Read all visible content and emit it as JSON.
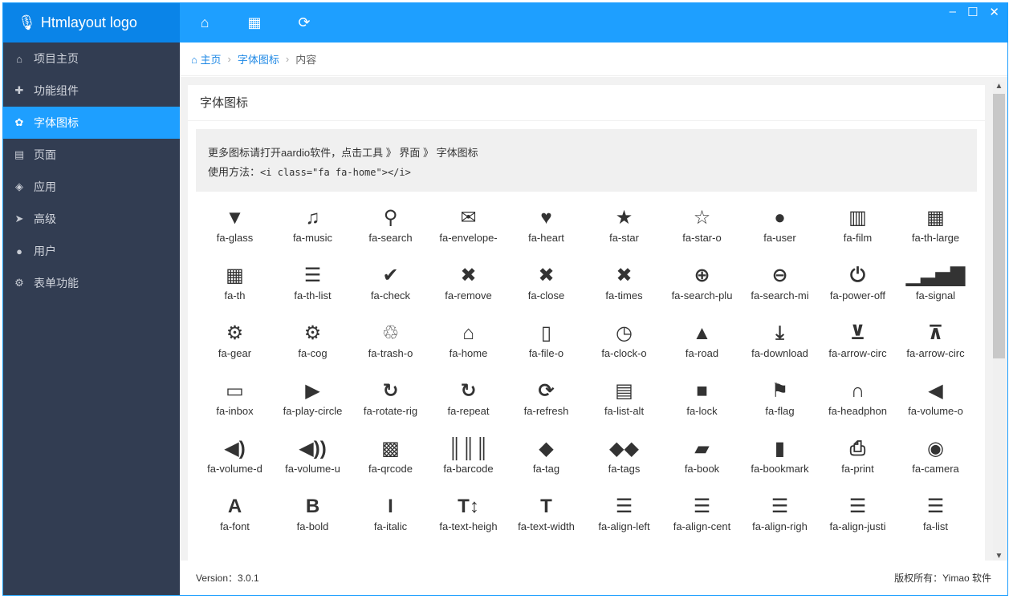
{
  "app": {
    "logo": "Htmlayout logo",
    "logo_icon": "microphone-icon"
  },
  "window": {
    "minimize": "–",
    "maximize": "☐",
    "close": "✕"
  },
  "toolbar": [
    {
      "icon": "home-icon",
      "glyph": "⌂"
    },
    {
      "icon": "calendar-icon",
      "glyph": "▦"
    },
    {
      "icon": "refresh-icon",
      "glyph": "⟳"
    }
  ],
  "sidebar": {
    "items": [
      {
        "label": "项目主页",
        "icon": "home-icon",
        "glyph": "⌂"
      },
      {
        "label": "功能组件",
        "icon": "puzzle-icon",
        "glyph": "✚"
      },
      {
        "label": "字体图标",
        "icon": "gift-icon",
        "glyph": "✿",
        "active": true
      },
      {
        "label": "页面",
        "icon": "file-text-icon",
        "glyph": "▤"
      },
      {
        "label": "应用",
        "icon": "cube-icon",
        "glyph": "◈"
      },
      {
        "label": "高级",
        "icon": "location-arrow-icon",
        "glyph": "➤"
      },
      {
        "label": "用户",
        "icon": "user-icon",
        "glyph": "●"
      },
      {
        "label": "表单功能",
        "icon": "gear-icon",
        "glyph": "⚙"
      }
    ]
  },
  "breadcrumb": {
    "home": "主页",
    "section": "字体图标",
    "current": "内容",
    "sep": "›"
  },
  "card": {
    "title": "字体图标",
    "note_line1": "更多图标请打开aardio软件，点击工具 》 界面 》 字体图标",
    "note_line2_prefix": "使用方法：",
    "note_line2_code": "<i class=\"fa fa-home\"></i>"
  },
  "icons": [
    {
      "g": "▼",
      "l": "fa-glass"
    },
    {
      "g": "♫",
      "l": "fa-music"
    },
    {
      "g": "⚲",
      "l": "fa-search"
    },
    {
      "g": "✉",
      "l": "fa-envelope-"
    },
    {
      "g": "♥",
      "l": "fa-heart"
    },
    {
      "g": "★",
      "l": "fa-star"
    },
    {
      "g": "☆",
      "l": "fa-star-o"
    },
    {
      "g": "●",
      "l": "fa-user"
    },
    {
      "g": "▥",
      "l": "fa-film"
    },
    {
      "g": "▦",
      "l": "fa-th-large"
    },
    {
      "g": "▦",
      "l": "fa-th"
    },
    {
      "g": "☰",
      "l": "fa-th-list"
    },
    {
      "g": "✔",
      "l": "fa-check"
    },
    {
      "g": "✖",
      "l": "fa-remove"
    },
    {
      "g": "✖",
      "l": "fa-close"
    },
    {
      "g": "✖",
      "l": "fa-times"
    },
    {
      "g": "⊕",
      "l": "fa-search-plu"
    },
    {
      "g": "⊖",
      "l": "fa-search-mi"
    },
    {
      "g": "⏻",
      "l": "fa-power-off"
    },
    {
      "g": "▁▃▅▇",
      "l": "fa-signal"
    },
    {
      "g": "⚙",
      "l": "fa-gear"
    },
    {
      "g": "⚙",
      "l": "fa-cog"
    },
    {
      "g": "♲",
      "l": "fa-trash-o"
    },
    {
      "g": "⌂",
      "l": "fa-home"
    },
    {
      "g": "▯",
      "l": "fa-file-o"
    },
    {
      "g": "◷",
      "l": "fa-clock-o"
    },
    {
      "g": "▲",
      "l": "fa-road"
    },
    {
      "g": "⤓",
      "l": "fa-download"
    },
    {
      "g": "⊻",
      "l": "fa-arrow-circ"
    },
    {
      "g": "⊼",
      "l": "fa-arrow-circ"
    },
    {
      "g": "▭",
      "l": "fa-inbox"
    },
    {
      "g": "▶",
      "l": "fa-play-circle"
    },
    {
      "g": "↻",
      "l": "fa-rotate-rig"
    },
    {
      "g": "↻",
      "l": "fa-repeat"
    },
    {
      "g": "⟳",
      "l": "fa-refresh"
    },
    {
      "g": "▤",
      "l": "fa-list-alt"
    },
    {
      "g": "■",
      "l": "fa-lock"
    },
    {
      "g": "⚑",
      "l": "fa-flag"
    },
    {
      "g": "∩",
      "l": "fa-headphon"
    },
    {
      "g": "◀",
      "l": "fa-volume-o"
    },
    {
      "g": "◀)",
      "l": "fa-volume-d"
    },
    {
      "g": "◀))",
      "l": "fa-volume-u"
    },
    {
      "g": "▩",
      "l": "fa-qrcode"
    },
    {
      "g": "║║║",
      "l": "fa-barcode"
    },
    {
      "g": "◆",
      "l": "fa-tag"
    },
    {
      "g": "◆◆",
      "l": "fa-tags"
    },
    {
      "g": "▰",
      "l": "fa-book"
    },
    {
      "g": "▮",
      "l": "fa-bookmark"
    },
    {
      "g": "⎙",
      "l": "fa-print"
    },
    {
      "g": "◉",
      "l": "fa-camera"
    },
    {
      "g": "A",
      "l": "fa-font"
    },
    {
      "g": "B",
      "l": "fa-bold"
    },
    {
      "g": "I",
      "l": "fa-italic"
    },
    {
      "g": "T↕",
      "l": "fa-text-heigh"
    },
    {
      "g": "T",
      "l": "fa-text-width"
    },
    {
      "g": "☰",
      "l": "fa-align-left"
    },
    {
      "g": "☰",
      "l": "fa-align-cent"
    },
    {
      "g": "☰",
      "l": "fa-align-righ"
    },
    {
      "g": "☰",
      "l": "fa-align-justi"
    },
    {
      "g": "☰",
      "l": "fa-list"
    }
  ],
  "footer": {
    "version": "Version：3.0.1",
    "copyright": "版权所有：Yimao 软件"
  },
  "colors": {
    "accent": "#1e9fff",
    "sidebar": "#323d52",
    "logo_bg": "#0a84e8"
  }
}
